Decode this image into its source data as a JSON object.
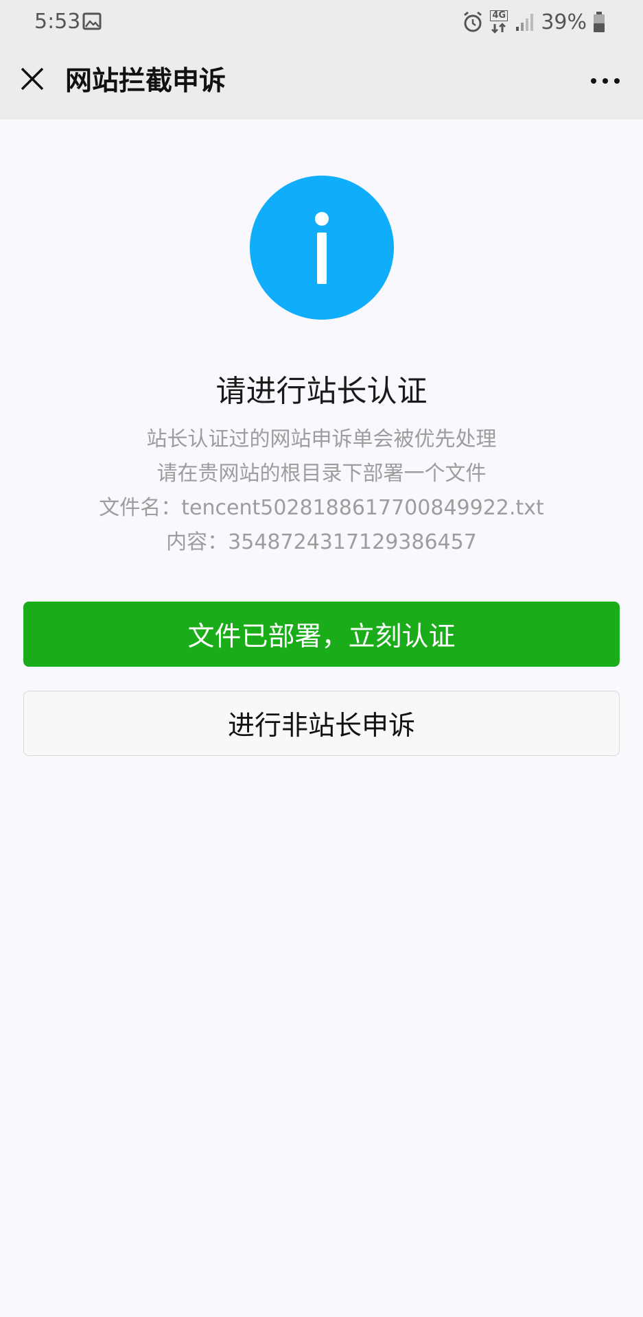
{
  "status_bar": {
    "time": "5:53",
    "network": "4G",
    "battery": "39%",
    "icons": [
      "gallery-icon",
      "alarm-icon",
      "network-4g-icon",
      "signal-icon",
      "battery-icon"
    ]
  },
  "app_bar": {
    "title": "网站拦截申诉",
    "icons": [
      "close-icon",
      "more-icon"
    ]
  },
  "main": {
    "icon": "info-icon",
    "icon_color": "#10adfb",
    "heading": "请进行站长认证",
    "lines": [
      "站长认证过的网站申诉单会被优先处理",
      "请在贵网站的根目录下部署一个文件",
      "文件名：tencent5028188617700849922.txt",
      "内容：3548724317129386457"
    ],
    "primary_button": "文件已部署，立刻认证",
    "secondary_button": "进行非站长申诉",
    "primary_color": "#1aad19"
  }
}
